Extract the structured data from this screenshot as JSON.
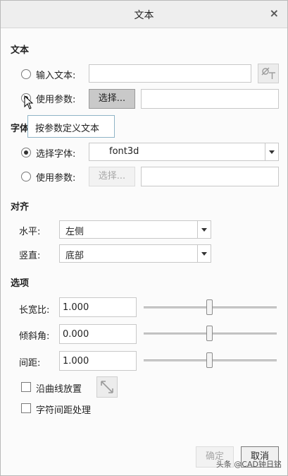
{
  "window": {
    "title": "文本",
    "close_glyph": "×"
  },
  "text_section": {
    "heading": "文本",
    "input_text_label": "输入文本:",
    "input_text_value": "",
    "use_param_label": "使用参数:",
    "select_button": "选择...",
    "param_value": "",
    "selected_option": "use_param"
  },
  "tooltip": {
    "text": "按参数定义文本"
  },
  "font_section": {
    "heading": "字体",
    "select_font_label": "选择字体:",
    "font_value": "font3d",
    "use_param_label": "使用参数:",
    "select_button": "选择...",
    "param_value": "",
    "selected_option": "select_font"
  },
  "align_section": {
    "heading": "对齐",
    "horizontal_label": "水平:",
    "horizontal_value": "左侧",
    "vertical_label": "竖直:",
    "vertical_value": "底部"
  },
  "options_section": {
    "heading": "选项",
    "aspect_label": "长宽比:",
    "aspect_value": "1.000",
    "slant_label": "倾斜角:",
    "slant_value": "0.000",
    "spacing_label": "间距:",
    "spacing_value": "1.000",
    "along_curve_label": "沿曲线放置",
    "along_curve_checked": false,
    "kerning_label": "字符间距处理",
    "kerning_checked": false
  },
  "footer": {
    "ok_button": "确定",
    "cancel_button": "取消",
    "watermark": "头条 @CAD钟日铭"
  }
}
